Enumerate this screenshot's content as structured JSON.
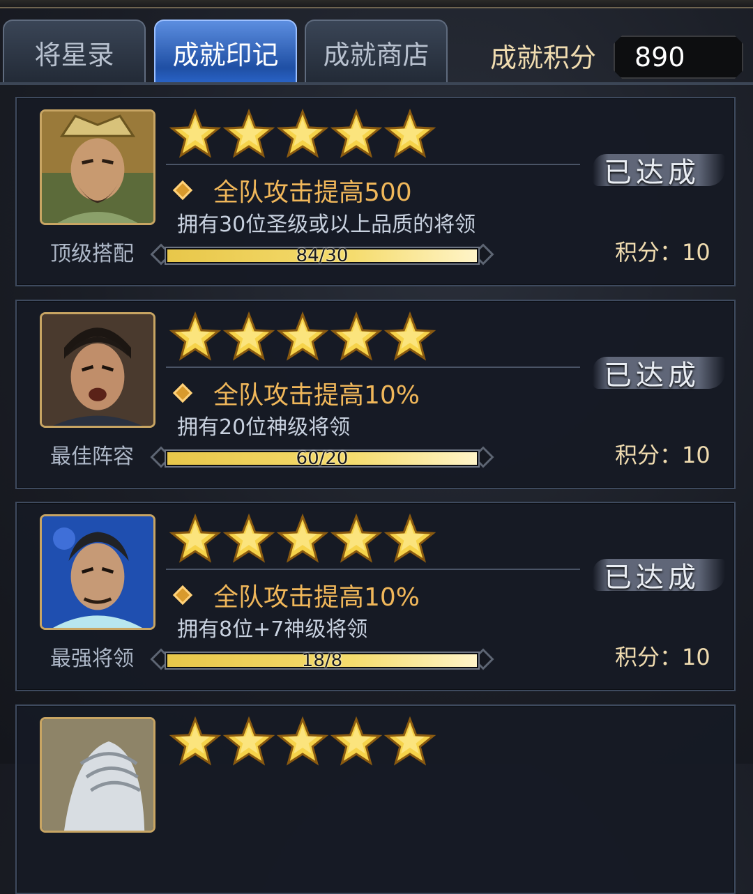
{
  "tabs": [
    {
      "label": "将星录",
      "active": false
    },
    {
      "label": "成就印记",
      "active": true
    },
    {
      "label": "成就商店",
      "active": false
    }
  ],
  "score": {
    "label": "成就积分",
    "value": "890"
  },
  "cards": [
    {
      "name": "顶级搭配",
      "stars": 5,
      "bonus": "全队攻击提高500",
      "desc": "拥有30位圣级或以上品质的将领",
      "progress": {
        "text": "84/30",
        "fraction": 1.0
      },
      "status": "已达成",
      "points": "积分：10"
    },
    {
      "name": "最佳阵容",
      "stars": 5,
      "bonus": "全队攻击提高10%",
      "desc": "拥有20位神级将领",
      "progress": {
        "text": "60/20",
        "fraction": 1.0
      },
      "status": "已达成",
      "points": "积分：10"
    },
    {
      "name": "最强将领",
      "stars": 5,
      "bonus": "全队攻击提高10%",
      "desc": "拥有8位+7神级将领",
      "progress": {
        "text": "18/8",
        "fraction": 1.0
      },
      "status": "已达成",
      "points": "积分：10"
    },
    {
      "name": "",
      "stars": 5
    }
  ],
  "colors": {
    "accent_blue": "#2a64c8",
    "gold": "#f0b75a",
    "star": "#f6d34a"
  },
  "icons": [
    "star-icon",
    "diamond-bullet-icon",
    "hero-portrait"
  ]
}
